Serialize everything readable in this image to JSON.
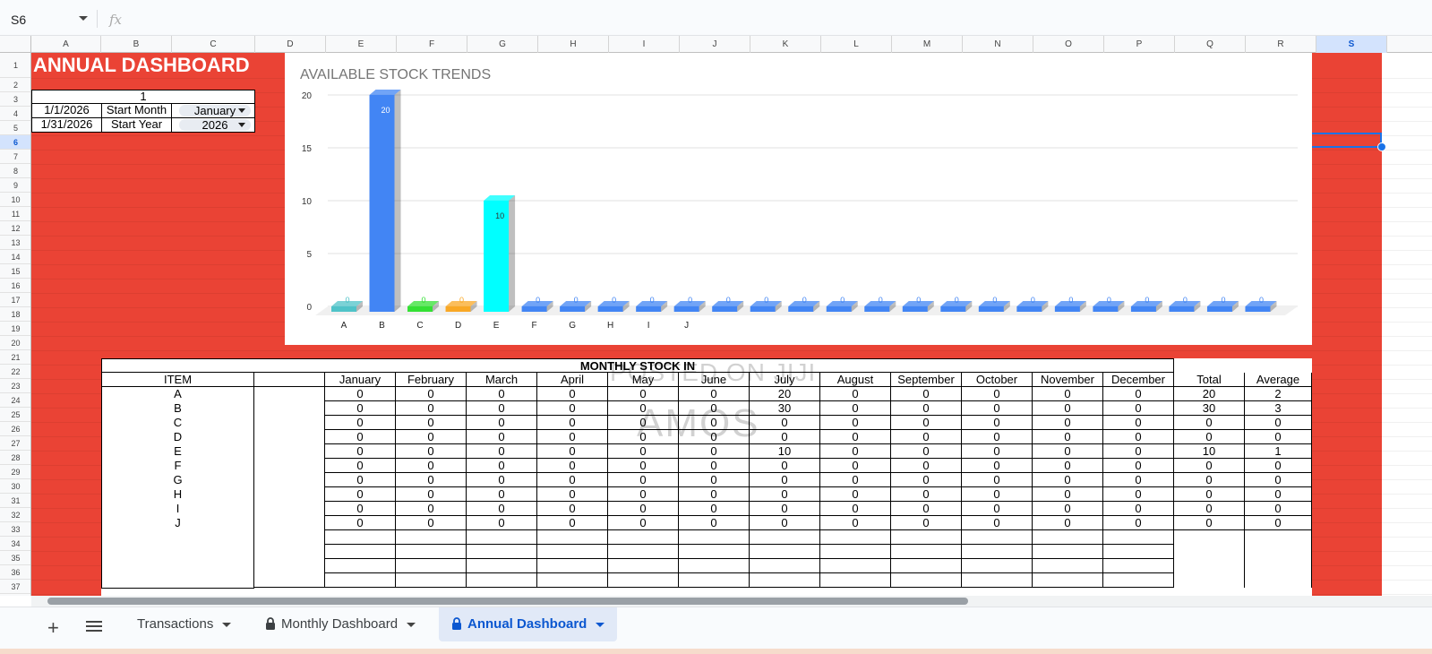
{
  "formula_bar": {
    "name_box": "S6",
    "fx": "fx"
  },
  "columns": [
    "A",
    "B",
    "C",
    "D",
    "E",
    "F",
    "G",
    "H",
    "I",
    "J",
    "K",
    "L",
    "M",
    "N",
    "O",
    "P",
    "Q",
    "R",
    "S"
  ],
  "selected_column": "S",
  "selected_row": "6",
  "rows": [
    "1",
    "2",
    "3",
    "4",
    "5",
    "6",
    "7",
    "8",
    "9",
    "10",
    "11",
    "12",
    "13",
    "14",
    "15",
    "16",
    "17",
    "18",
    "19",
    "20",
    "21",
    "22",
    "23",
    "24",
    "25",
    "26",
    "27",
    "28",
    "29",
    "30",
    "31",
    "32",
    "33",
    "34",
    "35",
    "36",
    "37"
  ],
  "dashboard": {
    "title": "ANNUAL DASHBOARD",
    "counter": "1",
    "start_date": "1/1/2026",
    "end_date": "1/31/2026",
    "start_month_label": "Start Month",
    "start_year_label": "Start Year",
    "start_month_value": "January",
    "start_year_value": "2026"
  },
  "chart_data": {
    "type": "bar",
    "title": "AVAILABLE STOCK TRENDS",
    "categories": [
      "A",
      "B",
      "C",
      "D",
      "E",
      "F",
      "G",
      "H",
      "I",
      "J",
      "",
      "",
      "",
      "",
      "",
      "",
      "",
      "",
      "",
      "",
      "",
      "",
      "",
      "",
      ""
    ],
    "values": [
      0,
      20,
      0,
      0,
      10,
      0,
      0,
      0,
      0,
      0,
      0,
      0,
      0,
      0,
      0,
      0,
      0,
      0,
      0,
      0,
      0,
      0,
      0,
      0,
      0
    ],
    "bar_colors": [
      "#4fc3c8",
      "#4285f4",
      "#34e034",
      "#f9a825",
      "#00ffff",
      "#4285f4",
      "#4285f4",
      "#4285f4",
      "#4285f4",
      "#4285f4",
      "#4285f4",
      "#4285f4",
      "#4285f4",
      "#4285f4",
      "#4285f4",
      "#4285f4",
      "#4285f4",
      "#4285f4",
      "#4285f4",
      "#4285f4",
      "#4285f4",
      "#4285f4",
      "#4285f4",
      "#4285f4",
      "#4285f4"
    ],
    "yticks": [
      "0",
      "5",
      "10",
      "15",
      "20"
    ],
    "ylim": [
      0,
      20
    ],
    "grid": true,
    "style": "3d"
  },
  "table": {
    "title": "MONTHLY STOCK IN",
    "item_header": "ITEM",
    "months": [
      "January",
      "February",
      "March",
      "April",
      "May",
      "June",
      "July",
      "August",
      "September",
      "October",
      "November",
      "December"
    ],
    "total_header": "Total",
    "average_header": "Average",
    "items": [
      {
        "name": "A",
        "values": [
          "0",
          "0",
          "0",
          "0",
          "0",
          "0",
          "20",
          "0",
          "0",
          "0",
          "0",
          "0"
        ],
        "total": "20",
        "average": "2"
      },
      {
        "name": "B",
        "values": [
          "0",
          "0",
          "0",
          "0",
          "0",
          "0",
          "30",
          "0",
          "0",
          "0",
          "0",
          "0"
        ],
        "total": "30",
        "average": "3"
      },
      {
        "name": "C",
        "values": [
          "0",
          "0",
          "0",
          "0",
          "0",
          "0",
          "0",
          "0",
          "0",
          "0",
          "0",
          "0"
        ],
        "total": "0",
        "average": "0"
      },
      {
        "name": "D",
        "values": [
          "0",
          "0",
          "0",
          "0",
          "0",
          "0",
          "0",
          "0",
          "0",
          "0",
          "0",
          "0"
        ],
        "total": "0",
        "average": "0"
      },
      {
        "name": "E",
        "values": [
          "0",
          "0",
          "0",
          "0",
          "0",
          "0",
          "10",
          "0",
          "0",
          "0",
          "0",
          "0"
        ],
        "total": "10",
        "average": "1"
      },
      {
        "name": "F",
        "values": [
          "0",
          "0",
          "0",
          "0",
          "0",
          "0",
          "0",
          "0",
          "0",
          "0",
          "0",
          "0"
        ],
        "total": "0",
        "average": "0"
      },
      {
        "name": "G",
        "values": [
          "0",
          "0",
          "0",
          "0",
          "0",
          "0",
          "0",
          "0",
          "0",
          "0",
          "0",
          "0"
        ],
        "total": "0",
        "average": "0"
      },
      {
        "name": "H",
        "values": [
          "0",
          "0",
          "0",
          "0",
          "0",
          "0",
          "0",
          "0",
          "0",
          "0",
          "0",
          "0"
        ],
        "total": "0",
        "average": "0"
      },
      {
        "name": "I",
        "values": [
          "0",
          "0",
          "0",
          "0",
          "0",
          "0",
          "0",
          "0",
          "0",
          "0",
          "0",
          "0"
        ],
        "total": "0",
        "average": "0"
      },
      {
        "name": "J",
        "values": [
          "0",
          "0",
          "0",
          "0",
          "0",
          "0",
          "0",
          "0",
          "0",
          "0",
          "0",
          "0"
        ],
        "total": "0",
        "average": "0"
      }
    ],
    "watermark_line1": "POSTED ON JIJI",
    "watermark_line2": "AMOS"
  },
  "sheet_tabs": [
    {
      "label": "Transactions",
      "locked": false,
      "active": false
    },
    {
      "label": "Monthly Dashboard",
      "locked": true,
      "active": false
    },
    {
      "label": "Annual Dashboard",
      "locked": true,
      "active": true
    }
  ],
  "colors": {
    "accent_red": "#ea4335",
    "selection_blue": "#1a73e8",
    "active_tab_text": "#0b57d0"
  }
}
